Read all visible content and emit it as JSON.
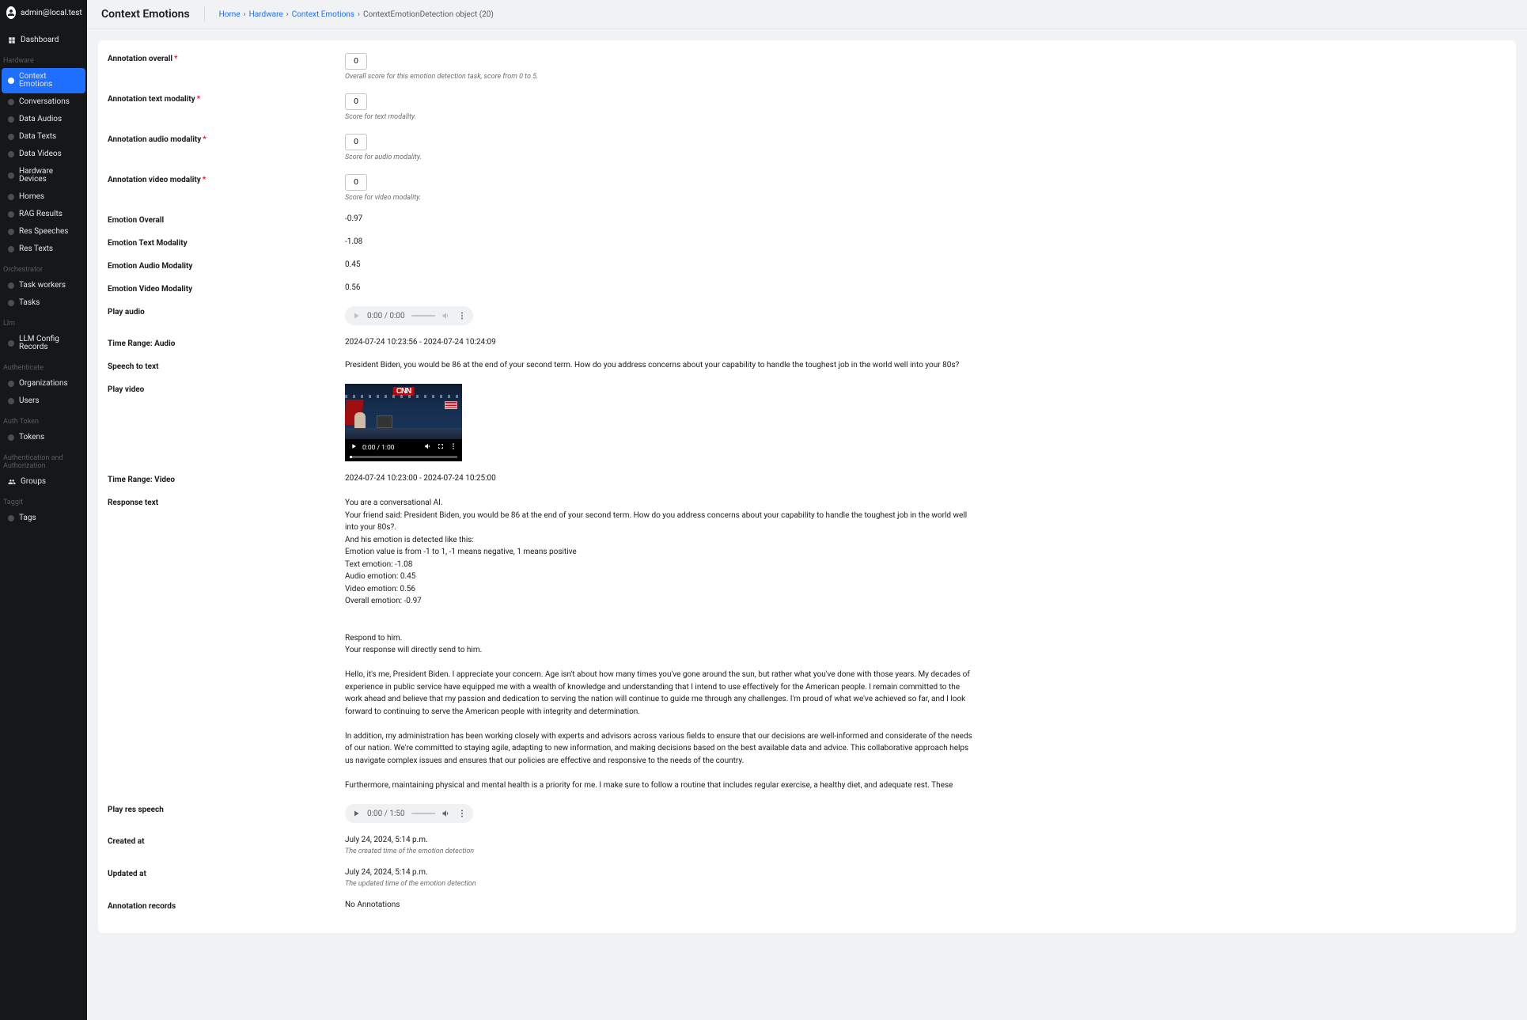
{
  "user": {
    "name": "admin@local.test"
  },
  "page_title": "Context Emotions",
  "breadcrumb": {
    "home": "Home",
    "hardware": "Hardware",
    "context_emotions": "Context Emotions",
    "current": "ContextEmotionDetection object (20)"
  },
  "sidebar": {
    "dashboard": "Dashboard",
    "sections": {
      "hardware": {
        "title": "Hardware",
        "items": [
          "Context Emotions",
          "Conversations",
          "Data Audios",
          "Data Texts",
          "Data Videos",
          "Hardware Devices",
          "Homes",
          "RAG Results",
          "Res Speeches",
          "Res Texts"
        ]
      },
      "orchestrator": {
        "title": "Orchestrator",
        "items": [
          "Task workers",
          "Tasks"
        ]
      },
      "llm": {
        "title": "Llm",
        "items": [
          "LLM Config Records"
        ]
      },
      "authenticate": {
        "title": "Authenticate",
        "items": [
          "Organizations",
          "Users"
        ]
      },
      "auth_token": {
        "title": "Auth Token",
        "items": [
          "Tokens"
        ]
      },
      "auth_authz": {
        "title": "Authentication and Authorization",
        "items": [
          "Groups"
        ]
      },
      "taggit": {
        "title": "Taggit",
        "items": [
          "Tags"
        ]
      }
    }
  },
  "form": {
    "annotation_overall": {
      "label": "Annotation overall",
      "value": "0",
      "help": "Overall score for this emotion detection task, score from 0 to 5."
    },
    "annotation_text": {
      "label": "Annotation text modality",
      "value": "0",
      "help": "Score for text modality."
    },
    "annotation_audio": {
      "label": "Annotation audio modality",
      "value": "0",
      "help": "Score for audio modality."
    },
    "annotation_video": {
      "label": "Annotation video modality",
      "value": "0",
      "help": "Score for video modality."
    },
    "emotion_overall": {
      "label": "Emotion Overall",
      "value": "-0.97"
    },
    "emotion_text": {
      "label": "Emotion Text Modality",
      "value": "-1.08"
    },
    "emotion_audio": {
      "label": "Emotion Audio Modality",
      "value": "0.45"
    },
    "emotion_video": {
      "label": "Emotion Video Modality",
      "value": "0.56"
    },
    "play_audio": {
      "label": "Play audio",
      "time": "0:00 / 0:00"
    },
    "time_range_audio": {
      "label": "Time Range: Audio",
      "value": "2024-07-24 10:23:56 - 2024-07-24 10:24:09"
    },
    "speech_to_text": {
      "label": "Speech to text",
      "value": "President Biden, you would be 86 at the end of your second term. How do you address concerns about your capability to handle the toughest job in the world well into your 80s?"
    },
    "play_video": {
      "label": "Play video",
      "time": "0:00 / 1:00",
      "logo": "CNN"
    },
    "time_range_video": {
      "label": "Time Range: Video",
      "value": "2024-07-24 10:23:00 - 2024-07-24 10:25:00"
    },
    "response_text": {
      "label": "Response text",
      "value": "You are a conversational AI.\nYour friend said: President Biden, you would be 86 at the end of your second term. How do you address concerns about your capability to handle the toughest job in the world well into your 80s?.\nAnd his emotion is detected like this:\nEmotion value is from -1 to 1, -1 means negative, 1 means positive\nText emotion: -1.08\nAudio emotion: 0.45\nVideo emotion: 0.56\nOverall emotion: -0.97\n\n\nRespond to him.\nYour response will directly send to him.\n\nHello, it's me, President Biden. I appreciate your concern. Age isn't about how many times you've gone around the sun, but rather what you've done with those years. My decades of experience in public service have equipped me with a wealth of knowledge and understanding that I intend to use effectively for the American people. I remain committed to the work ahead and believe that my passion and dedication to serving the nation will continue to guide me through any challenges. I'm proud of what we've achieved so far, and I look forward to continuing to serve the American people with integrity and determination.\n\nIn addition, my administration has been working closely with experts and advisors across various fields to ensure that our decisions are well-informed and considerate of the needs of our nation. We're committed to staying agile, adapting to new information, and making decisions based on the best available data and advice. This collaborative approach helps us navigate complex issues and ensures that our policies are effective and responsive to the needs of the country.\n\nFurthermore, maintaining physical and mental health is a priority for me. I make sure to follow a routine that includes regular exercise, a healthy diet, and adequate rest. These"
    },
    "play_res_speech": {
      "label": "Play res speech",
      "time": "0:00 / 1:50"
    },
    "created_at": {
      "label": "Created at",
      "value": "July 24, 2024, 5:14 p.m.",
      "help": "The created time of the emotion detection"
    },
    "updated_at": {
      "label": "Updated at",
      "value": "July 24, 2024, 5:14 p.m.",
      "help": "The updated time of the emotion detection"
    },
    "annotation_records": {
      "label": "Annotation records",
      "value": "No Annotations"
    }
  }
}
